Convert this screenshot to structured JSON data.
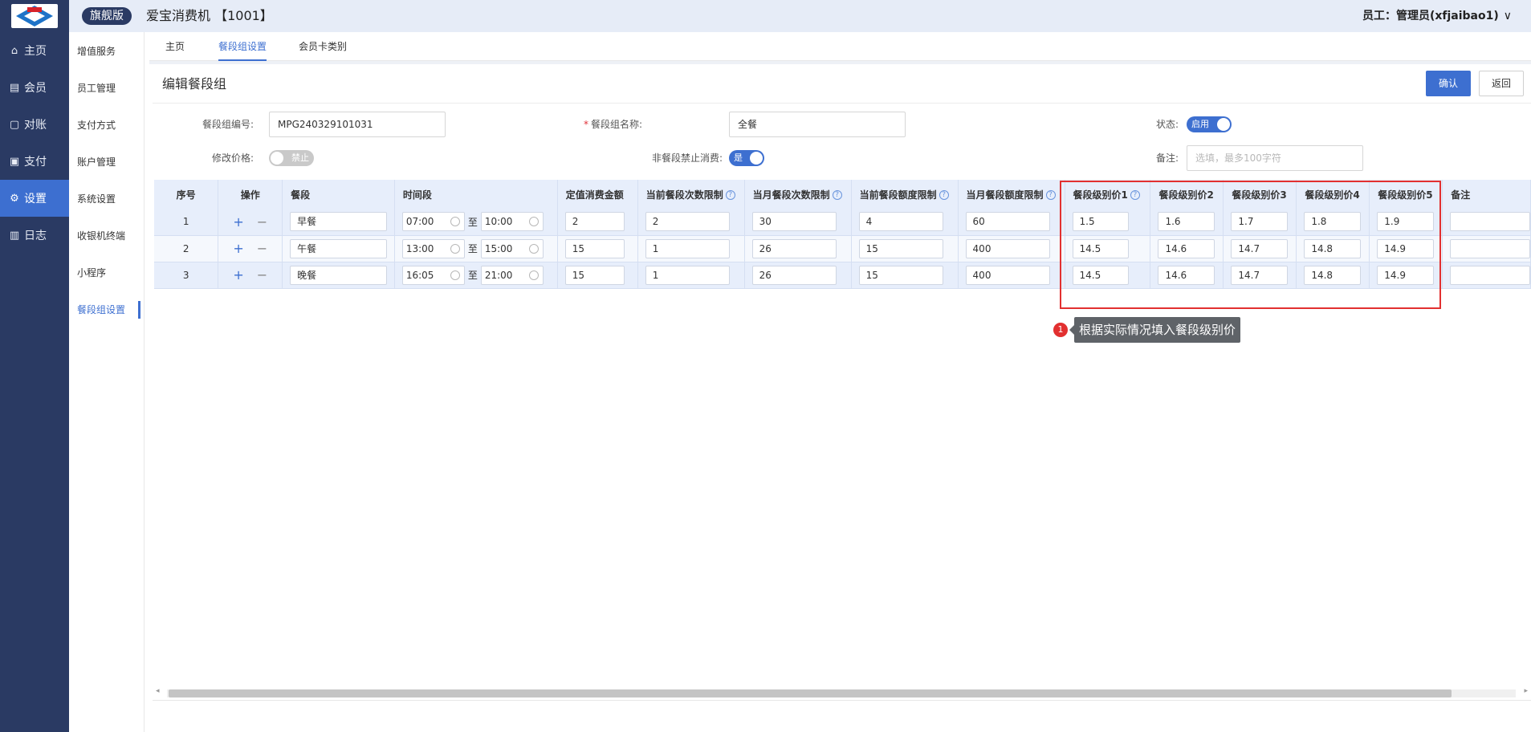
{
  "header": {
    "edition": "旗舰版",
    "title": "爱宝消费机 【1001】",
    "user": "员工：管理员(xfjaibao1)",
    "user_chevron": "∨"
  },
  "leftnav": [
    {
      "label": "主页",
      "icon": "home-icon"
    },
    {
      "label": "会员",
      "icon": "member-icon"
    },
    {
      "label": "对账",
      "icon": "reconcile-icon"
    },
    {
      "label": "支付",
      "icon": "payment-icon"
    },
    {
      "label": "设置",
      "icon": "gear-icon",
      "active": true
    },
    {
      "label": "日志",
      "icon": "log-icon"
    }
  ],
  "subnav": [
    "增值服务",
    "员工管理",
    "支付方式",
    "账户管理",
    "系统设置",
    "收银机终端",
    "小程序",
    "餐段组设置"
  ],
  "tabs": [
    "主页",
    "餐段组设置",
    "会员卡类别"
  ],
  "page": {
    "title": "编辑餐段组",
    "confirm_label": "确认",
    "back_label": "返回"
  },
  "form": {
    "group_code_label": "餐段组编号:",
    "group_code_value": "MPG240329101031",
    "group_name_required": "*",
    "group_name_label": "餐段组名称:",
    "group_name_value": "全餐",
    "status_label": "状态:",
    "status_toggle": "启用",
    "modify_price_label": "修改价格:",
    "modify_price_toggle": "禁止",
    "non_meal_label": "非餐段禁止消费:",
    "non_meal_toggle": "是",
    "remark_label": "备注:",
    "remark_placeholder": "选填，最多100字符"
  },
  "table": {
    "headers": [
      "序号",
      "操作",
      "餐段",
      "时间段",
      "定值消费金额",
      "当前餐段次数限制",
      "当月餐段次数限制",
      "当前餐段额度限制",
      "当月餐段额度限制",
      "餐段级别价1",
      "餐段级别价2",
      "餐段级别价3",
      "餐段级别价4",
      "餐段级别价5",
      "备注"
    ],
    "help_mark": "?",
    "plus": "+",
    "minus": "−",
    "to": "至",
    "rows": [
      {
        "no": "1",
        "meal": "早餐",
        "start": "07:00",
        "end": "10:00",
        "fixed": "2",
        "cur_count": "2",
        "month_count": "30",
        "cur_amount": "4",
        "month_amount": "60",
        "p1": "1.5",
        "p2": "1.6",
        "p3": "1.7",
        "p4": "1.8",
        "p5": "1.9",
        "remark": ""
      },
      {
        "no": "2",
        "meal": "午餐",
        "start": "13:00",
        "end": "15:00",
        "fixed": "15",
        "cur_count": "1",
        "month_count": "26",
        "cur_amount": "15",
        "month_amount": "400",
        "p1": "14.5",
        "p2": "14.6",
        "p3": "14.7",
        "p4": "14.8",
        "p5": "14.9",
        "remark": ""
      },
      {
        "no": "3",
        "meal": "晚餐",
        "start": "16:05",
        "end": "21:00",
        "fixed": "15",
        "cur_count": "1",
        "month_count": "26",
        "cur_amount": "15",
        "month_amount": "400",
        "p1": "14.5",
        "p2": "14.6",
        "p3": "14.7",
        "p4": "14.8",
        "p5": "14.9",
        "remark": ""
      }
    ]
  },
  "annotation": {
    "number": "1",
    "text": "根据实际情况填入餐段级别价",
    "color": "#e23030"
  },
  "scroll": {
    "left_arrow": "◂",
    "right_arrow": "▸"
  }
}
